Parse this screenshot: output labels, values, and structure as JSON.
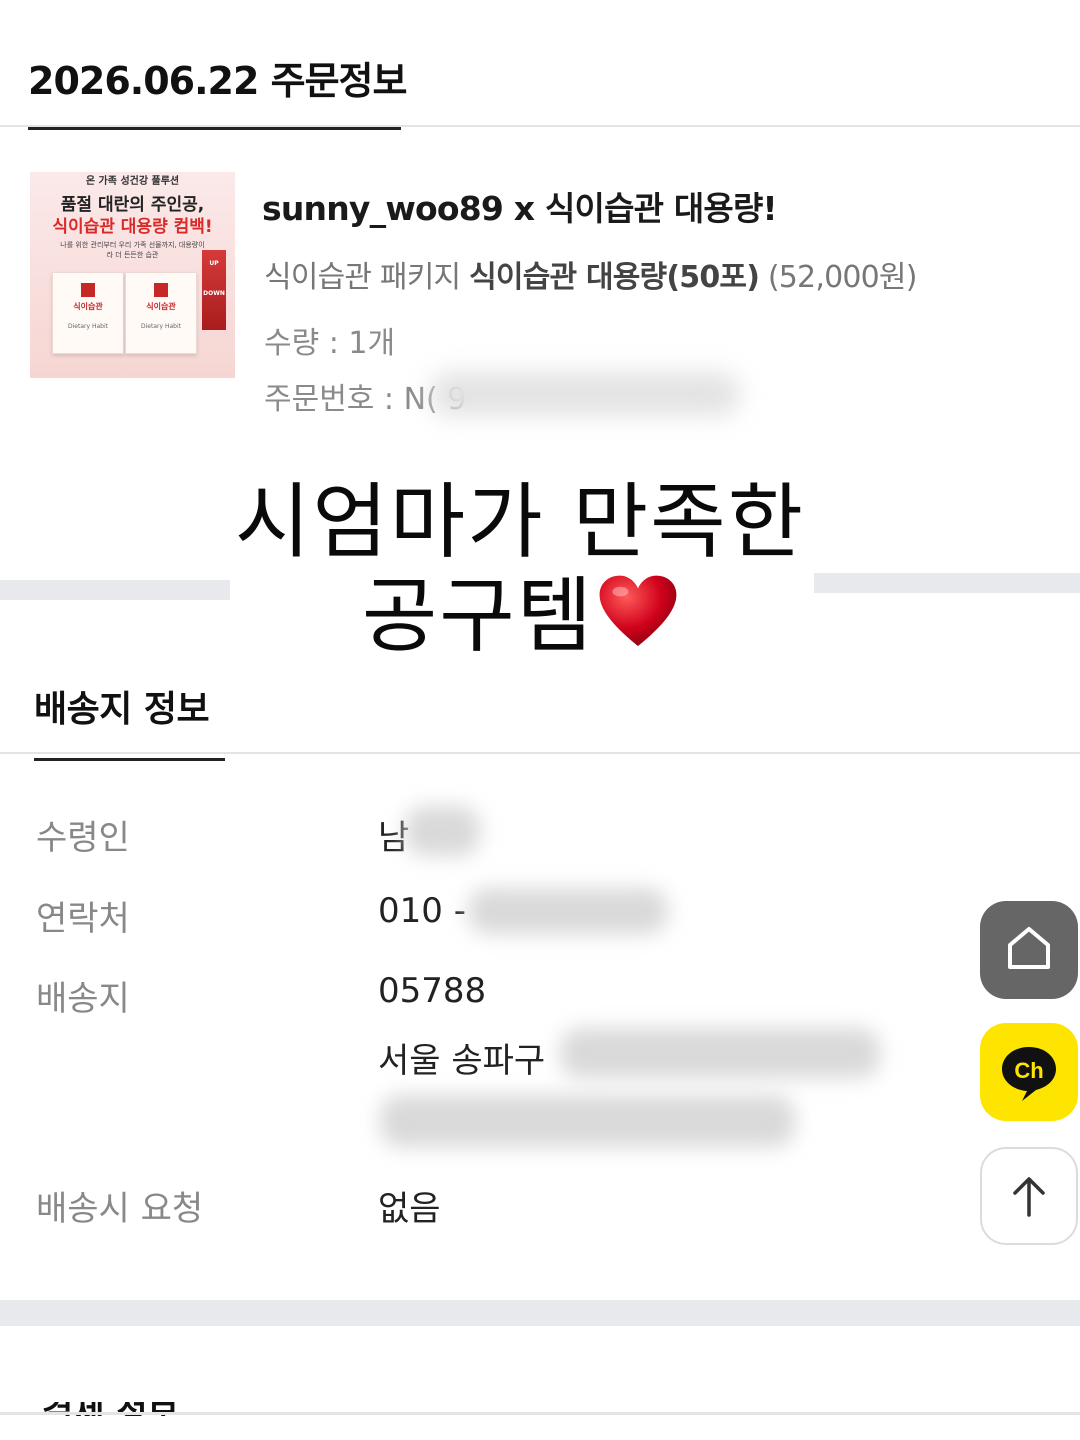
{
  "order": {
    "header": "2026.06.22 주문정보",
    "thumbnail": {
      "top_text": "온 가족 성건강 풀루션",
      "line1": "품절 대란의 주인공,",
      "line2": "식이습관 대용량 컴백!",
      "sub": "나를 위한 관리부터 우리 가족 선물까지, 대용량이라 더 든든한 습관",
      "pkg_name": "식이습관",
      "pkg_en": "Dietary Habit",
      "up_label": "UP",
      "down_label": "DOWN"
    },
    "product_title": "sunny_woo89 x 식이습관 대용량!",
    "option_prefix": "식이습관 패키지",
    "option_name": "식이습관 대용량(50포)",
    "option_price": "(52,000원)",
    "quantity": "수량 : 1개",
    "order_number": "주문번호 : N(              9"
  },
  "story": {
    "line1": "시엄마가 만족한",
    "line2": "공구템"
  },
  "shipping": {
    "title": "배송지 정보",
    "rows": [
      {
        "label": "수령인",
        "value": "남"
      },
      {
        "label": "연락처",
        "value": "010 -"
      },
      {
        "label": "배송지",
        "value": "05788",
        "value2": "서울 송파구"
      },
      {
        "label": "배송시 요청",
        "value": "없음"
      }
    ]
  },
  "fab": {
    "home_icon": "home-icon",
    "chat_label": "Ch",
    "top_icon": "arrow-up-icon"
  },
  "next_section": {
    "title": "결제 정보"
  },
  "colors": {
    "kakao_yellow": "#fee500",
    "home_gray": "#666666",
    "heart_red": "#d0021b"
  }
}
